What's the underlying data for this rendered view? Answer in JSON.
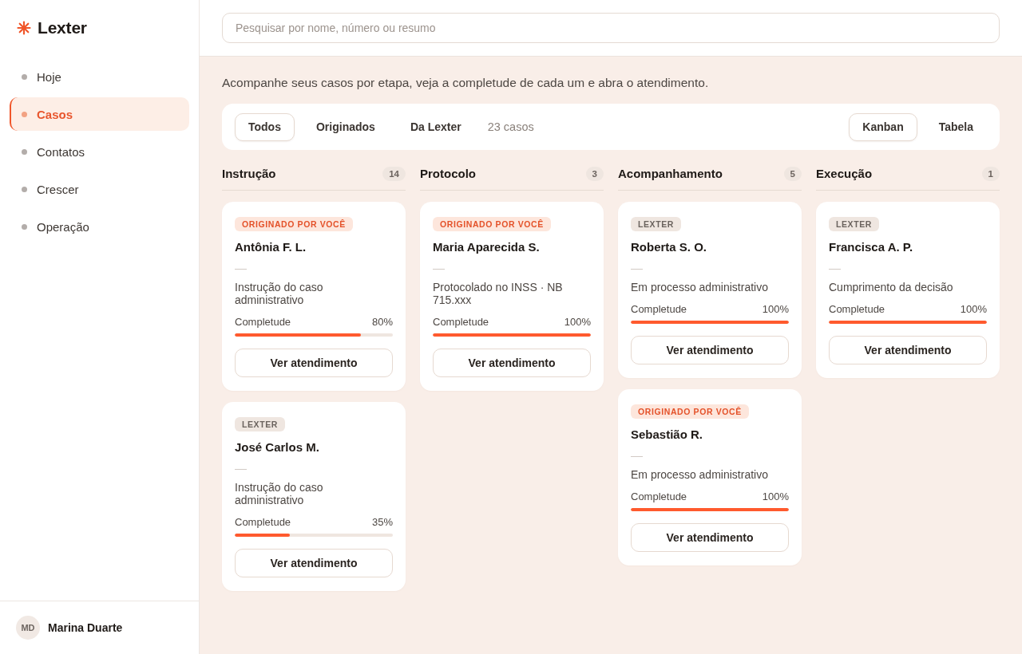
{
  "sidebar": {
    "brand": "Lexter",
    "nav": [
      {
        "label": "Hoje",
        "selected": false
      },
      {
        "label": "Casos",
        "selected": true
      },
      {
        "label": "Contatos",
        "selected": false
      },
      {
        "label": "Crescer",
        "selected": false
      },
      {
        "label": "Operação",
        "selected": false
      }
    ],
    "user": {
      "initials": "MD",
      "name": "Marina Duarte"
    }
  },
  "search": {
    "placeholder": "Pesquisar por nome, número ou resumo"
  },
  "intro": "Acompanhe seus casos por etapa, veja a completude de cada um e abra o atendimento.",
  "filters": {
    "tabs": [
      {
        "label": "Todos",
        "selected": true
      },
      {
        "label": "Originados",
        "selected": false
      },
      {
        "label": "Da Lexter",
        "selected": false
      }
    ],
    "count": "23 casos",
    "views": [
      {
        "label": "Kanban",
        "selected": true
      },
      {
        "label": "Tabela",
        "selected": false
      }
    ]
  },
  "columns": [
    {
      "title": "Instrução",
      "count": "14",
      "cards": [
        {
          "tag": {
            "kind": "origin",
            "label": "ORIGINADO POR VOCÊ"
          },
          "name": "Antônia F. L.",
          "detail": "—",
          "status": "Instrução do caso administrativo",
          "progress_label": "Completude",
          "progress_value": "80%",
          "level": 0.8,
          "action": "Ver atendimento"
        },
        {
          "tag": {
            "kind": "lexter",
            "label": "LEXTER"
          },
          "name": "José Carlos M.",
          "detail": "—",
          "status": "Instrução do caso administrativo",
          "progress_label": "Completude",
          "progress_value": "35%",
          "level": 0.35,
          "action": "Ver atendimento"
        }
      ]
    },
    {
      "title": "Protocolo",
      "count": "3",
      "cards": [
        {
          "tag": {
            "kind": "origin",
            "label": "ORIGINADO POR VOCÊ"
          },
          "name": "Maria Aparecida S.",
          "detail": "—",
          "status": "Protocolado no INSS · NB 715.xxx",
          "progress_label": "Completude",
          "progress_value": "100%",
          "level": 1,
          "action": "Ver atendimento"
        }
      ]
    },
    {
      "title": "Acompanhamento",
      "count": "5",
      "cards": [
        {
          "tag": {
            "kind": "lexter",
            "label": "LEXTER"
          },
          "name": "Roberta S. O.",
          "detail": "—",
          "status": "Em processo administrativo",
          "progress_label": "Completude",
          "progress_value": "100%",
          "level": 1,
          "action": "Ver atendimento"
        },
        {
          "tag": {
            "kind": "origin",
            "label": "ORIGINADO POR VOCÊ"
          },
          "name": "Sebastião R.",
          "detail": "—",
          "status": "Em processo administrativo",
          "progress_label": "Completude",
          "progress_value": "100%",
          "level": 1,
          "action": "Ver atendimento"
        }
      ]
    },
    {
      "title": "Execução",
      "count": "1",
      "cards": [
        {
          "tag": {
            "kind": "lexter",
            "label": "LEXTER"
          },
          "name": "Francisca A. P.",
          "detail": "—",
          "status": "Cumprimento da decisão",
          "progress_label": "Completude",
          "progress_value": "100%",
          "level": 1,
          "action": "Ver atendimento"
        }
      ]
    }
  ]
}
